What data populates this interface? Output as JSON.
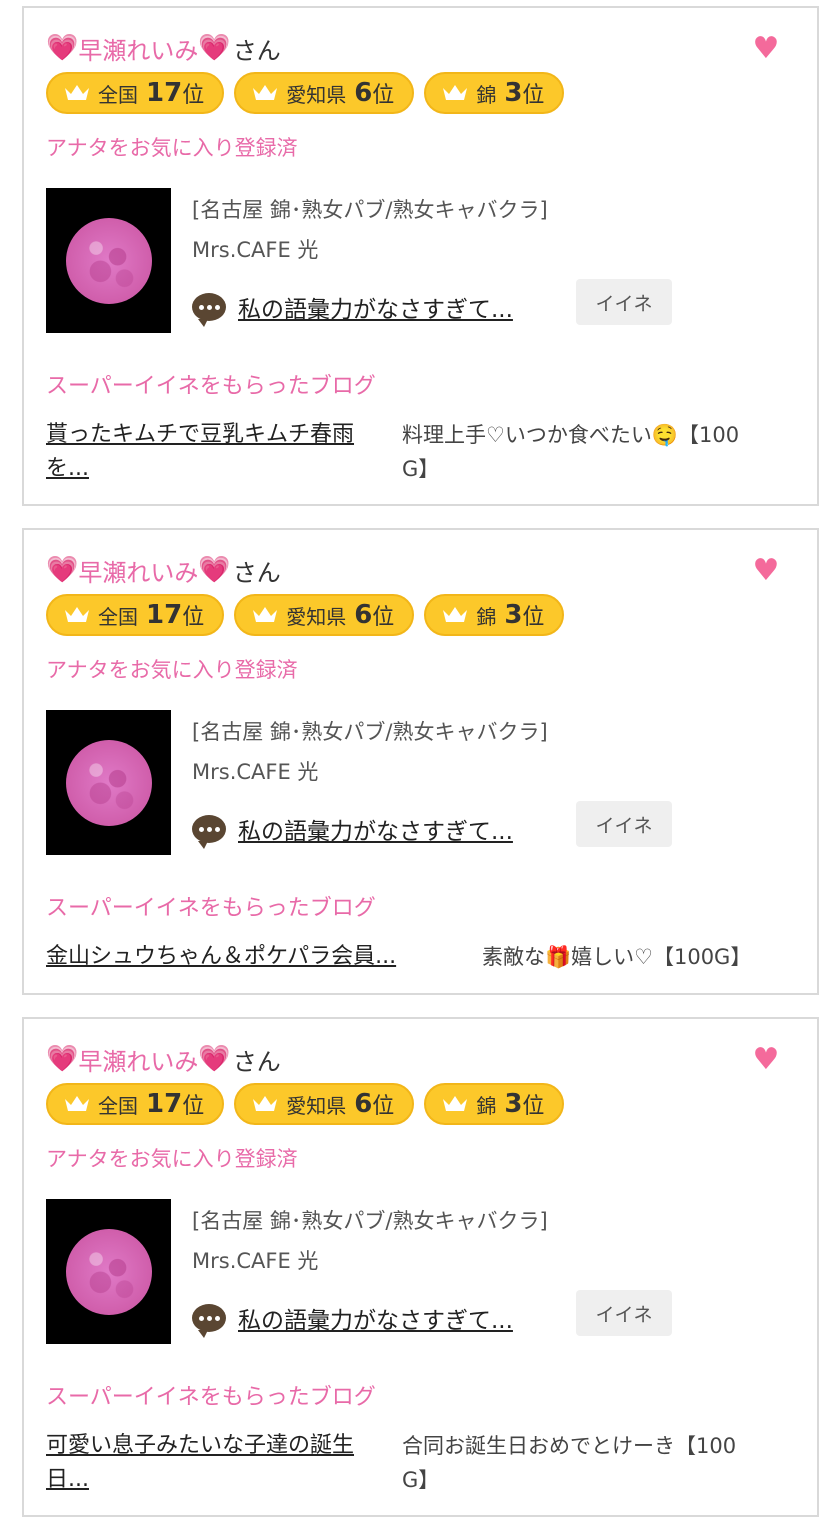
{
  "cards": [
    {
      "user_name": "早瀬れいみ",
      "honorific": "さん",
      "badges": [
        {
          "region": "全国",
          "rank": "17",
          "suffix": "位"
        },
        {
          "region": "愛知県",
          "rank": "6",
          "suffix": "位"
        },
        {
          "region": "錦",
          "rank": "3",
          "suffix": "位"
        }
      ],
      "favorite_status": "アナタをお気に入り登録済",
      "shop_category": "[名古屋 錦･熟女パブ/熟女キャバクラ]",
      "shop_name": "Mrs.CAFE 光",
      "post_title": "私の語彙力がなさすぎて...",
      "like_label": "イイネ",
      "super_like_heading": "スーパーイイネをもらったブログ",
      "blog_title_line1": "貰ったキムチで豆乳キムチ春雨",
      "blog_title_line2": "を...",
      "blog_comment_line1": "料理上手♡いつか食べたい🤤【100",
      "blog_comment_line2": "G】"
    },
    {
      "user_name": "早瀬れいみ",
      "honorific": "さん",
      "badges": [
        {
          "region": "全国",
          "rank": "17",
          "suffix": "位"
        },
        {
          "region": "愛知県",
          "rank": "6",
          "suffix": "位"
        },
        {
          "region": "錦",
          "rank": "3",
          "suffix": "位"
        }
      ],
      "favorite_status": "アナタをお気に入り登録済",
      "shop_category": "[名古屋 錦･熟女パブ/熟女キャバクラ]",
      "shop_name": "Mrs.CAFE 光",
      "post_title": "私の語彙力がなさすぎて...",
      "like_label": "イイネ",
      "super_like_heading": "スーパーイイネをもらったブログ",
      "blog_title_line1": "金山シュウちゃん＆ポケパラ会員...",
      "blog_title_line2": "",
      "blog_comment_line1": "素敵な🎁嬉しい♡【100G】",
      "blog_comment_line2": ""
    },
    {
      "user_name": "早瀬れいみ",
      "honorific": "さん",
      "badges": [
        {
          "region": "全国",
          "rank": "17",
          "suffix": "位"
        },
        {
          "region": "愛知県",
          "rank": "6",
          "suffix": "位"
        },
        {
          "region": "錦",
          "rank": "3",
          "suffix": "位"
        }
      ],
      "favorite_status": "アナタをお気に入り登録済",
      "shop_category": "[名古屋 錦･熟女パブ/熟女キャバクラ]",
      "shop_name": "Mrs.CAFE 光",
      "post_title": "私の語彙力がなさすぎて...",
      "like_label": "イイネ",
      "super_like_heading": "スーパーイイネをもらったブログ",
      "blog_title_line1": "可愛い息子みたいな子達の誕生",
      "blog_title_line2": "日...",
      "blog_comment_line1": "合同お誕生日おめでとけーき【100",
      "blog_comment_line2": "G】"
    }
  ],
  "icons": {
    "name_heart": "pink-heart-emoji",
    "favorite": "heart-icon",
    "badge": "crown-icon",
    "post": "speech-bubble-icon",
    "thumbnail": "pink-moon-photo"
  },
  "colors": {
    "accent_pink": "#e86aa8",
    "heart_pink": "#f46a9b",
    "badge_yellow": "#fcc82a",
    "card_border": "#d9d9d9"
  }
}
